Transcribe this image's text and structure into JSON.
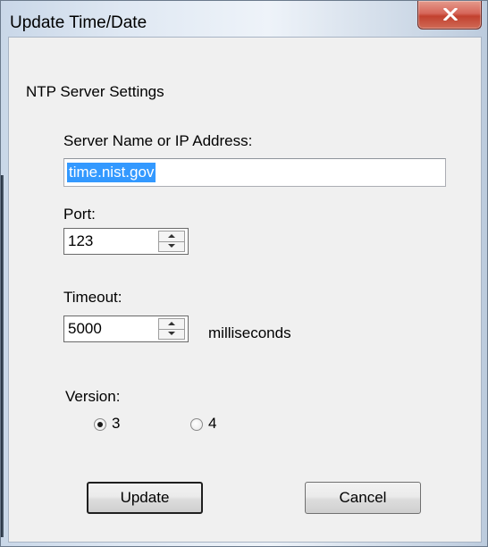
{
  "window": {
    "title": "Update Time/Date"
  },
  "group": {
    "label": "NTP Server Settings"
  },
  "server": {
    "label": "Server Name or IP Address:",
    "value": "time.nist.gov"
  },
  "port": {
    "label": "Port:",
    "value": "123"
  },
  "timeout": {
    "label": "Timeout:",
    "value": "5000",
    "unit": "milliseconds"
  },
  "version": {
    "label": "Version:",
    "options": [
      {
        "label": "3",
        "selected": true
      },
      {
        "label": "4",
        "selected": false
      }
    ]
  },
  "buttons": {
    "update": "Update",
    "cancel": "Cancel"
  },
  "icons": {
    "close": "close-icon",
    "spin_up": "spin-up-arrow-icon",
    "spin_down": "spin-down-arrow-icon"
  },
  "colors": {
    "selection": "#3399ff",
    "close_button": "#c2412f"
  }
}
